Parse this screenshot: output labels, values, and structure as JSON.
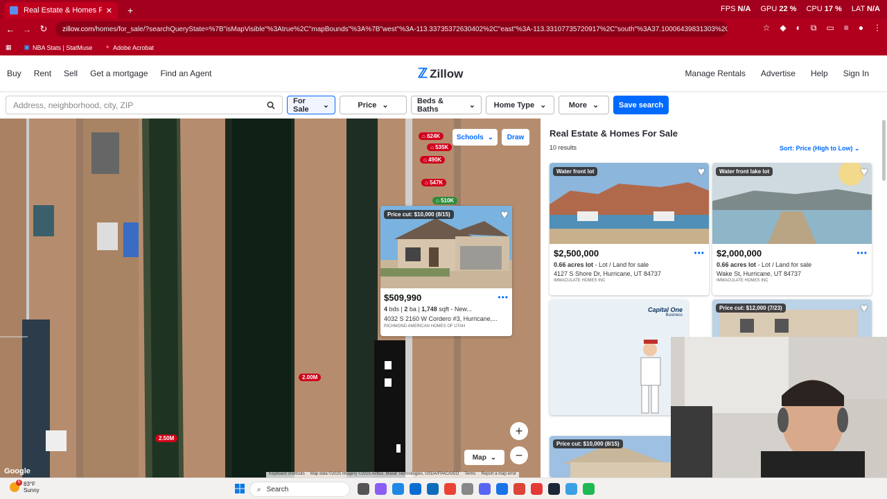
{
  "browser": {
    "tab_title": "Real Estate & Homes For Sale -",
    "url_host": "zillow.com",
    "url_path": "/homes/for_sale/?searchQueryState=%7B\"isMapVisible\"%3Atrue%2C\"mapBounds\"%3A%7B\"west\"%3A-113.33735372630402%2C\"east\"%3A-113.33107735720917%2C\"south\"%3A37.10006439831303%2C\"north\"%3A37...",
    "stats": {
      "fps_label": "FPS",
      "fps_value": "N/A",
      "gpu_label": "GPU",
      "gpu_value": "22 %",
      "cpu_label": "CPU",
      "cpu_value": "17 %",
      "lat_label": "LAT",
      "lat_value": "N/A"
    },
    "bookmarks": [
      "NBA Stats | StatMuse",
      "Adobe Acrobat"
    ]
  },
  "header": {
    "nav_left": [
      "Buy",
      "Rent",
      "Sell",
      "Get a mortgage",
      "Find an Agent"
    ],
    "logo": "Zillow",
    "nav_right": [
      "Manage Rentals",
      "Advertise",
      "Help",
      "Sign In"
    ]
  },
  "filters": {
    "search_placeholder": "Address, neighborhood, city, ZIP",
    "buttons": [
      "For Sale",
      "Price",
      "Beds & Baths",
      "Home Type",
      "More"
    ],
    "save": "Save search"
  },
  "map": {
    "pins": [
      {
        "label": "624K",
        "color": "red"
      },
      {
        "label": "535K",
        "color": "red"
      },
      {
        "label": "490K",
        "color": "red"
      },
      {
        "label": "547K",
        "color": "red"
      },
      {
        "label": "510K",
        "color": "green"
      },
      {
        "label": "2.00M",
        "color": "red"
      },
      {
        "label": "2.50M",
        "color": "red"
      }
    ],
    "schools": "Schools",
    "draw": "Draw",
    "map_type": "Map",
    "google": "Google",
    "attribution": [
      "Keyboard shortcuts",
      "Map data ©2025 Imagery ©2025 Airbus, Maxar Technologies, USDA/FPAC/GEO",
      "Terms",
      "Report a map error"
    ],
    "popup": {
      "badge": "Price cut: $10,000 (8/15)",
      "price": "$509,990",
      "beds": "4",
      "beds_unit": "bds",
      "baths": "2",
      "baths_unit": "ba",
      "sqft": "1,748",
      "sqft_unit": "sqft",
      "status": "- New...",
      "address": "4032 S 2160 W Cordero #3, Hurricane,...",
      "broker": "RICHMOND AMERICAN HOMES OF UTAH"
    }
  },
  "listing": {
    "title": "Real Estate & Homes For Sale",
    "count": "10 results",
    "sort": "Sort: Price (High to Low)",
    "cards": [
      {
        "badge": "Water front lot",
        "price": "$2,500,000",
        "size": "0.66 acres lot",
        "type": "- Lot / Land for sale",
        "address": "4127 S Shore Dr, Hurricane, UT 84737",
        "broker": "IMMACULATE HOMES INC"
      },
      {
        "badge": "Water front lake lot",
        "price": "$2,000,000",
        "size": "0.66 acres lot",
        "type": "- Lot / Land for sale",
        "address": "Wake St, Hurricane, UT 84737",
        "broker": "IMMACULATE HOMES INC"
      },
      {
        "badge": "Price cut: $12,000 (7/23)"
      },
      {
        "badge": "Price cut: $10,000 (8/15)"
      }
    ],
    "ad_brand": "Capital One",
    "ad_sub": "Business"
  },
  "taskbar": {
    "temp": "83°F",
    "condition": "Sunny",
    "search": "Search",
    "weather_badge": "6"
  }
}
